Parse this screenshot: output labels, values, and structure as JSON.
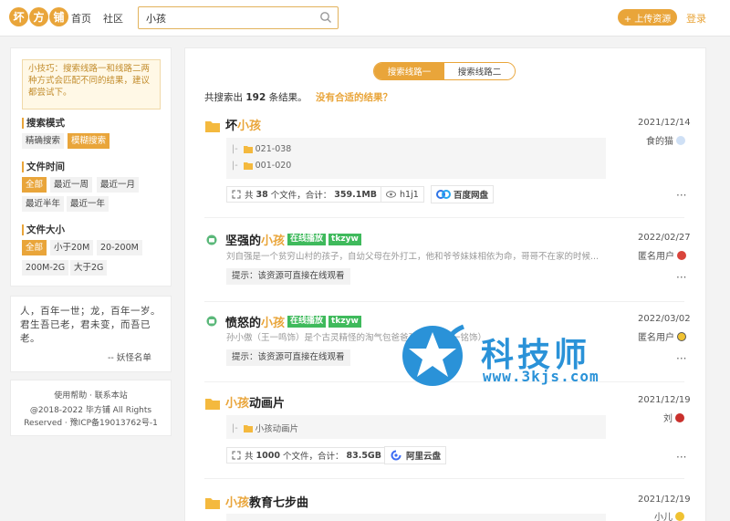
{
  "header": {
    "logo_chars": [
      "坏",
      "方",
      "铺"
    ],
    "nav": [
      "首页",
      "社区"
    ],
    "search_value": "小孩",
    "upload_label": "+ 上传资源",
    "login_label": "登录"
  },
  "sidebar": {
    "tip": "小技巧：搜索线路一和线路二两种方式会匹配不同的结果，建议都尝试下。",
    "mode_title": "搜索模式",
    "mode_options": [
      "精确搜索",
      "模糊搜索"
    ],
    "time_title": "文件时间",
    "time_options": [
      "全部",
      "最近一周",
      "最近一月",
      "最近半年",
      "最近一年"
    ],
    "size_title": "文件大小",
    "size_options": [
      "全部",
      "小于20M",
      "20-200M",
      "200M-2G",
      "大于2G"
    ],
    "quote_lines": [
      "人，百年一世；龙，百年一岁。",
      "君生吾已老，君未变，而吾已老。"
    ],
    "quote_source": "-- 妖怪名单",
    "footer_links": "使用帮助 · 联系本站",
    "copyright_1": "@2018-2022 毕方铺 All Rights",
    "copyright_2": "Reserved · 豫ICP备19013762号-1"
  },
  "main": {
    "tabs": [
      "搜索线路一",
      "搜索线路二"
    ],
    "summary_prefix": "共搜索出",
    "summary_count": "192",
    "summary_suffix": "条结果。",
    "summary_hint": "没有合适的结果？",
    "results": [
      {
        "title_pre": "坏",
        "title_hl": "小孩",
        "title_post": "",
        "date": "2021/12/14",
        "owner": "食的猫",
        "files": [
          "021-038",
          "001-020"
        ],
        "file_count_prefix": "共",
        "file_count": "38",
        "file_count_suffix": "个文件，合计：",
        "total_size": "359.1MB",
        "views": "h1j1",
        "disk": "百度网盘"
      },
      {
        "title_pre": "坚强的",
        "title_hl": "小孩",
        "badges": [
          "在线播放",
          "tkzyw"
        ],
        "date": "2022/02/27",
        "owner": "匿名用户",
        "desc": "刘自强是一个贫穷山村的孩子，自幼父母在外打工，他和爷爷妹妹相依为命，哥哥不在家的时候...",
        "notice": "提示：该资源可直接在线观看"
      },
      {
        "title_pre": "愤怒的",
        "title_hl": "小孩",
        "badges": [
          "在线播放",
          "tkzyw"
        ],
        "date": "2022/03/02",
        "owner": "匿名用户",
        "desc": "孙小傲（王一鸣饰）是个古灵精怪的淘气包爸爸孙立业（张一铭饰）",
        "notice": "提示：该资源可直接在线观看"
      },
      {
        "title_pre": "",
        "title_hl": "小孩",
        "title_post": "动画片",
        "date": "2021/12/19",
        "owner": "刘",
        "files": [
          "小孩动画片"
        ],
        "file_count_prefix": "共",
        "file_count": "1000",
        "file_count_suffix": "个文件，合计：",
        "total_size": "83.5GB",
        "disk": "阿里云盘"
      },
      {
        "title_pre": "",
        "title_hl": "小孩",
        "title_post": "教育七步曲",
        "date": "2021/12/19",
        "owner": "小儿"
      }
    ]
  },
  "watermark": {
    "text": "科技师",
    "url": "www.3kjs.com"
  },
  "colors": {
    "accent": "#e9a53a",
    "green": "#3fba5c",
    "watermark": "#2a92d8"
  }
}
